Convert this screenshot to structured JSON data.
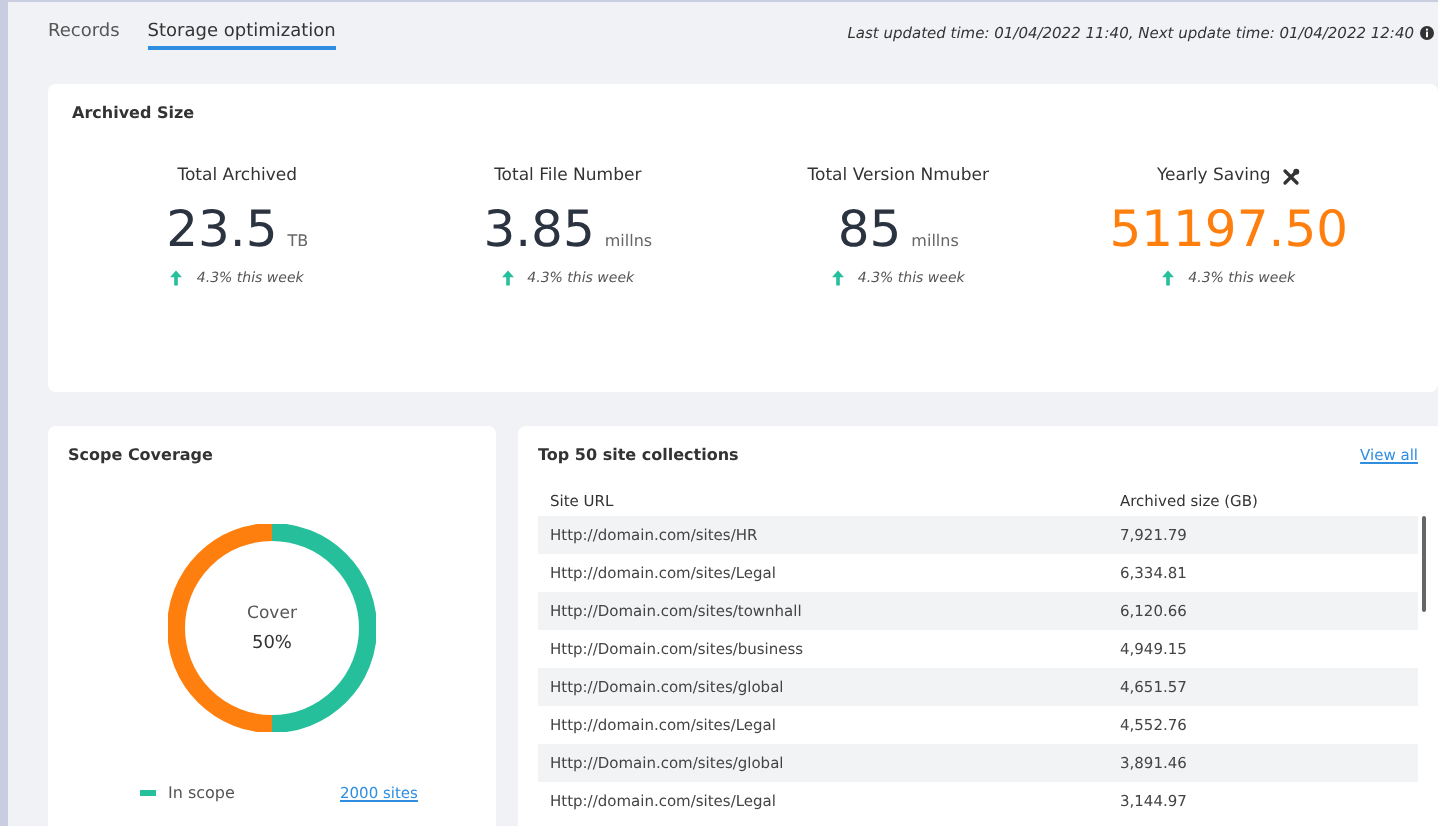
{
  "tabs": [
    {
      "label": "Records",
      "selected": false
    },
    {
      "label": "Storage optimization",
      "selected": true
    }
  ],
  "update_info": "Last updated time: 01/04/2022 11:40, Next update time: 01/04/2022 12:40",
  "archived_size": {
    "title": "Archived Size",
    "stats": [
      {
        "label": "Total Archived",
        "value": "23.5",
        "unit": "TB",
        "highlight": false,
        "tool_icon": false,
        "trend": "4.3% this week"
      },
      {
        "label": "Total File Number",
        "value": "3.85",
        "unit": "millns",
        "highlight": false,
        "tool_icon": false,
        "trend": "4.3% this week"
      },
      {
        "label": "Total Version Nmuber",
        "value": "85",
        "unit": "millns",
        "highlight": false,
        "tool_icon": false,
        "trend": "4.3% this week"
      },
      {
        "label": "Yearly Saving",
        "value": "51197.50",
        "highlight": true,
        "tool_icon": true,
        "trend": "4.3% this week"
      }
    ]
  },
  "scope_coverage": {
    "title": "Scope Coverage",
    "center_label": "Cover",
    "center_value": "50%",
    "legend": [
      {
        "label": "In scope",
        "link": "2000 sites",
        "color": "#26bf9c"
      }
    ]
  },
  "site_collections": {
    "title": "Top 50 site collections",
    "view_all": "View all",
    "columns": [
      "Site URL",
      "Archived size (GB)"
    ],
    "rows": [
      [
        "Http://domain.com/sites/HR",
        "7,921.79"
      ],
      [
        "Http://domain.com/sites/Legal",
        "6,334.81"
      ],
      [
        "Http://Domain.com/sites/townhall",
        "6,120.66"
      ],
      [
        "Http://Domain.com/sites/business",
        "4,949.15"
      ],
      [
        "Http://Domain.com/sites/global",
        "4,651.57"
      ],
      [
        "Http://domain.com/sites/Legal",
        "4,552.76"
      ],
      [
        "Http://Domain.com/sites/global",
        "3,891.46"
      ],
      [
        "Http://domain.com/sites/Legal",
        "3,144.97"
      ]
    ]
  }
}
